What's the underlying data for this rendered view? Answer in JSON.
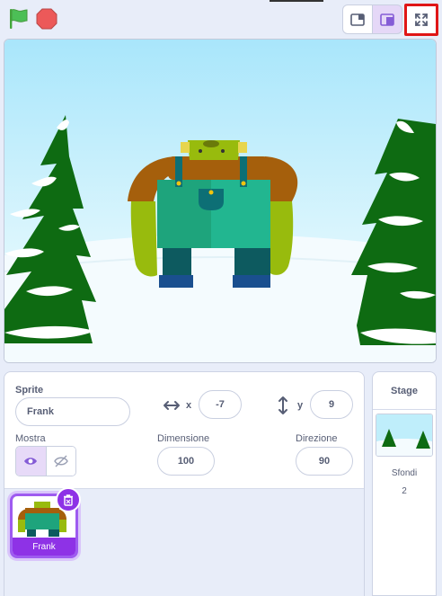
{
  "toolbar": {
    "green_flag_icon": "green-flag-icon",
    "stop_icon": "stop-icon",
    "small_stage_icon": "small-stage-icon",
    "large_stage_icon": "large-stage-icon",
    "fullscreen_icon": "fullscreen-icon"
  },
  "sprite_info": {
    "sprite_label": "Sprite",
    "sprite_name": "Frank",
    "x_label": "x",
    "x_value": "-7",
    "y_label": "y",
    "y_value": "9",
    "show_label": "Mostra",
    "size_label": "Dimensione",
    "size_value": "100",
    "direction_label": "Direzione",
    "direction_value": "90"
  },
  "sprites": [
    {
      "name": "Frank",
      "selected": true
    }
  ],
  "stage_panel": {
    "title": "Stage",
    "backdrops_label": "Sfondi",
    "backdrops_count": "2"
  },
  "colors": {
    "accent": "#8e32e6",
    "selected_bg": "#e7daf8",
    "highlight_red": "#e01616",
    "sky": "#bfeefb",
    "tree": "#0e6b12"
  }
}
